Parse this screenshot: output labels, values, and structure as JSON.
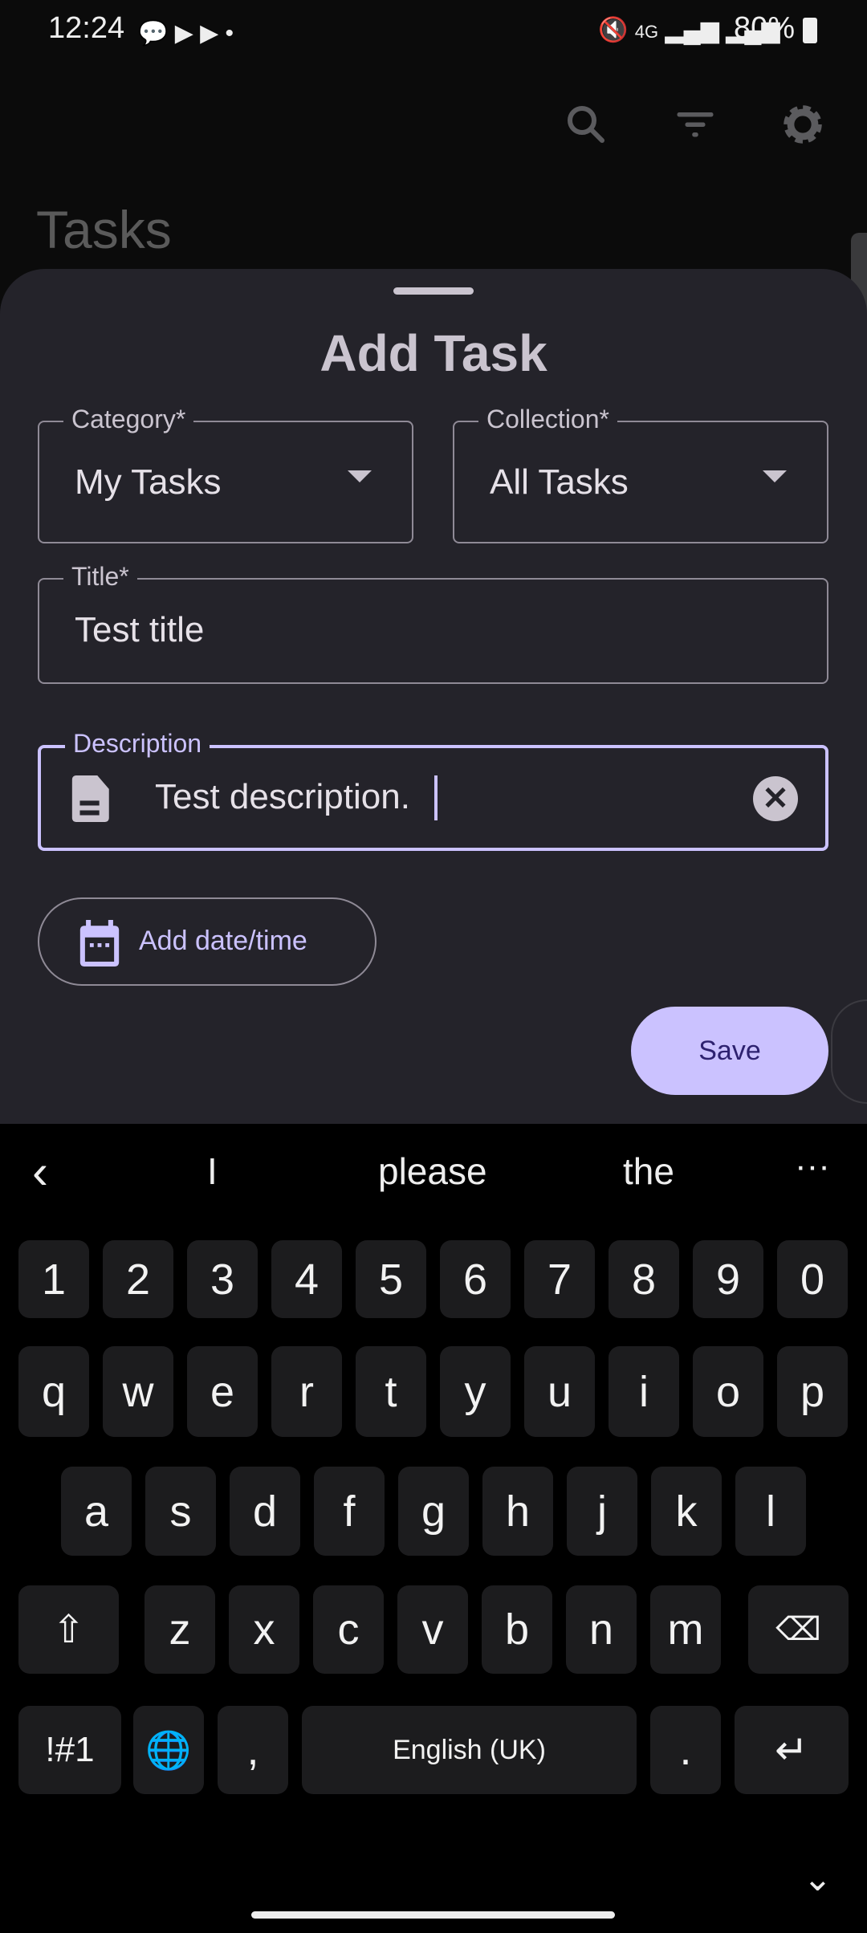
{
  "status_bar": {
    "time": "12:24",
    "network": "4G",
    "battery": "80%"
  },
  "app_bar": {
    "title": "Tasks",
    "icons": [
      "search-icon",
      "filter-icon",
      "gear-icon"
    ]
  },
  "sheet": {
    "title": "Add Task",
    "category": {
      "label": "Category*",
      "value": "My Tasks"
    },
    "collection": {
      "label": "Collection*",
      "value": "All Tasks"
    },
    "title_field": {
      "label": "Title*",
      "value": "Test title"
    },
    "description": {
      "label": "Description",
      "value": "Test description."
    },
    "add_date_label": "Add date/time",
    "save_label": "Save"
  },
  "colors": {
    "accent": "#cbc2ff",
    "sheet_bg": "#24232a",
    "on_accent": "#2e2270"
  },
  "keyboard": {
    "suggestions": [
      "I",
      "please",
      "the"
    ],
    "rows": [
      [
        "1",
        "2",
        "3",
        "4",
        "5",
        "6",
        "7",
        "8",
        "9",
        "0"
      ],
      [
        "q",
        "w",
        "e",
        "r",
        "t",
        "y",
        "u",
        "i",
        "o",
        "p"
      ],
      [
        "a",
        "s",
        "d",
        "f",
        "g",
        "h",
        "j",
        "k",
        "l"
      ],
      [
        "z",
        "x",
        "c",
        "v",
        "b",
        "n",
        "m"
      ]
    ],
    "symbols_label": "!#1",
    "comma": ",",
    "space_label": "English (UK)",
    "period": "."
  }
}
